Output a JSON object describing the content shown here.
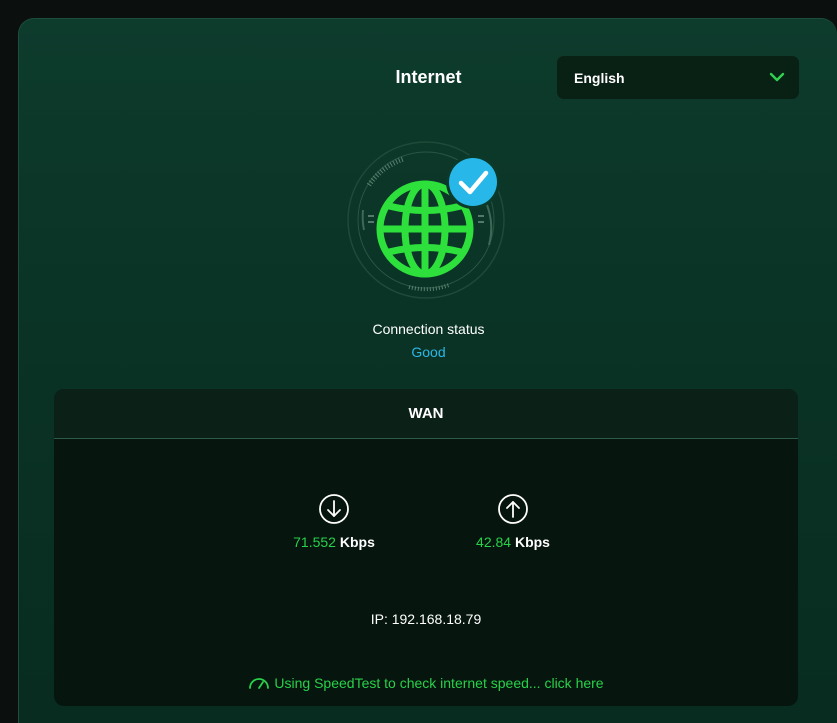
{
  "header": {
    "title": "Internet"
  },
  "language": {
    "selected": "English"
  },
  "connection": {
    "label": "Connection status",
    "value": "Good"
  },
  "wan": {
    "title": "WAN",
    "download": {
      "value": "71.552",
      "unit": "Kbps"
    },
    "upload": {
      "value": "42.84",
      "unit": "Kbps"
    },
    "ip": "IP: 192.168.18.79",
    "speedtest_link": "Using SpeedTest to check internet speed... click here"
  },
  "colors": {
    "accent_green": "#28d14a",
    "status_blue": "#2bb8e6",
    "card_bg": "#0a3325",
    "panel_bg": "#06150e"
  },
  "icons": {
    "globe": "globe-icon",
    "check": "check-badge-icon",
    "download": "download-arrow-icon",
    "upload": "upload-arrow-icon",
    "speedtest": "speedometer-icon",
    "dropdown": "chevron-down-icon"
  }
}
